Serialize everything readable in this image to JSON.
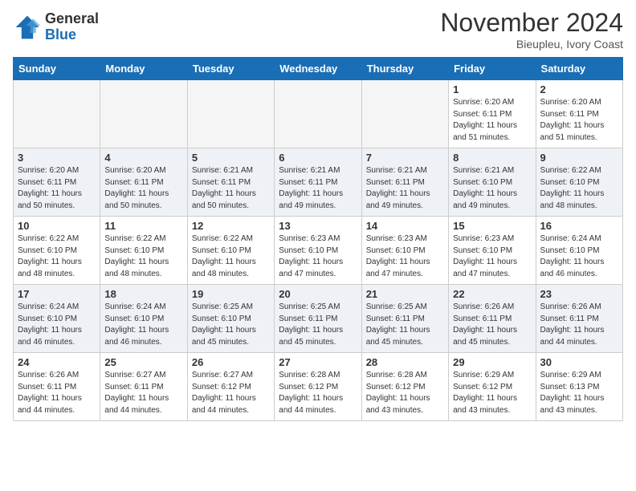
{
  "header": {
    "logo": {
      "general": "General",
      "blue": "Blue"
    },
    "title": "November 2024",
    "location": "Bieupleu, Ivory Coast"
  },
  "weekdays": [
    "Sunday",
    "Monday",
    "Tuesday",
    "Wednesday",
    "Thursday",
    "Friday",
    "Saturday"
  ],
  "weeks": [
    [
      {
        "day": "",
        "info": ""
      },
      {
        "day": "",
        "info": ""
      },
      {
        "day": "",
        "info": ""
      },
      {
        "day": "",
        "info": ""
      },
      {
        "day": "",
        "info": ""
      },
      {
        "day": "1",
        "info": "Sunrise: 6:20 AM\nSunset: 6:11 PM\nDaylight: 11 hours\nand 51 minutes."
      },
      {
        "day": "2",
        "info": "Sunrise: 6:20 AM\nSunset: 6:11 PM\nDaylight: 11 hours\nand 51 minutes."
      }
    ],
    [
      {
        "day": "3",
        "info": "Sunrise: 6:20 AM\nSunset: 6:11 PM\nDaylight: 11 hours\nand 50 minutes."
      },
      {
        "day": "4",
        "info": "Sunrise: 6:20 AM\nSunset: 6:11 PM\nDaylight: 11 hours\nand 50 minutes."
      },
      {
        "day": "5",
        "info": "Sunrise: 6:21 AM\nSunset: 6:11 PM\nDaylight: 11 hours\nand 50 minutes."
      },
      {
        "day": "6",
        "info": "Sunrise: 6:21 AM\nSunset: 6:11 PM\nDaylight: 11 hours\nand 49 minutes."
      },
      {
        "day": "7",
        "info": "Sunrise: 6:21 AM\nSunset: 6:11 PM\nDaylight: 11 hours\nand 49 minutes."
      },
      {
        "day": "8",
        "info": "Sunrise: 6:21 AM\nSunset: 6:10 PM\nDaylight: 11 hours\nand 49 minutes."
      },
      {
        "day": "9",
        "info": "Sunrise: 6:22 AM\nSunset: 6:10 PM\nDaylight: 11 hours\nand 48 minutes."
      }
    ],
    [
      {
        "day": "10",
        "info": "Sunrise: 6:22 AM\nSunset: 6:10 PM\nDaylight: 11 hours\nand 48 minutes."
      },
      {
        "day": "11",
        "info": "Sunrise: 6:22 AM\nSunset: 6:10 PM\nDaylight: 11 hours\nand 48 minutes."
      },
      {
        "day": "12",
        "info": "Sunrise: 6:22 AM\nSunset: 6:10 PM\nDaylight: 11 hours\nand 48 minutes."
      },
      {
        "day": "13",
        "info": "Sunrise: 6:23 AM\nSunset: 6:10 PM\nDaylight: 11 hours\nand 47 minutes."
      },
      {
        "day": "14",
        "info": "Sunrise: 6:23 AM\nSunset: 6:10 PM\nDaylight: 11 hours\nand 47 minutes."
      },
      {
        "day": "15",
        "info": "Sunrise: 6:23 AM\nSunset: 6:10 PM\nDaylight: 11 hours\nand 47 minutes."
      },
      {
        "day": "16",
        "info": "Sunrise: 6:24 AM\nSunset: 6:10 PM\nDaylight: 11 hours\nand 46 minutes."
      }
    ],
    [
      {
        "day": "17",
        "info": "Sunrise: 6:24 AM\nSunset: 6:10 PM\nDaylight: 11 hours\nand 46 minutes."
      },
      {
        "day": "18",
        "info": "Sunrise: 6:24 AM\nSunset: 6:10 PM\nDaylight: 11 hours\nand 46 minutes."
      },
      {
        "day": "19",
        "info": "Sunrise: 6:25 AM\nSunset: 6:10 PM\nDaylight: 11 hours\nand 45 minutes."
      },
      {
        "day": "20",
        "info": "Sunrise: 6:25 AM\nSunset: 6:11 PM\nDaylight: 11 hours\nand 45 minutes."
      },
      {
        "day": "21",
        "info": "Sunrise: 6:25 AM\nSunset: 6:11 PM\nDaylight: 11 hours\nand 45 minutes."
      },
      {
        "day": "22",
        "info": "Sunrise: 6:26 AM\nSunset: 6:11 PM\nDaylight: 11 hours\nand 45 minutes."
      },
      {
        "day": "23",
        "info": "Sunrise: 6:26 AM\nSunset: 6:11 PM\nDaylight: 11 hours\nand 44 minutes."
      }
    ],
    [
      {
        "day": "24",
        "info": "Sunrise: 6:26 AM\nSunset: 6:11 PM\nDaylight: 11 hours\nand 44 minutes."
      },
      {
        "day": "25",
        "info": "Sunrise: 6:27 AM\nSunset: 6:11 PM\nDaylight: 11 hours\nand 44 minutes."
      },
      {
        "day": "26",
        "info": "Sunrise: 6:27 AM\nSunset: 6:12 PM\nDaylight: 11 hours\nand 44 minutes."
      },
      {
        "day": "27",
        "info": "Sunrise: 6:28 AM\nSunset: 6:12 PM\nDaylight: 11 hours\nand 44 minutes."
      },
      {
        "day": "28",
        "info": "Sunrise: 6:28 AM\nSunset: 6:12 PM\nDaylight: 11 hours\nand 43 minutes."
      },
      {
        "day": "29",
        "info": "Sunrise: 6:29 AM\nSunset: 6:12 PM\nDaylight: 11 hours\nand 43 minutes."
      },
      {
        "day": "30",
        "info": "Sunrise: 6:29 AM\nSunset: 6:13 PM\nDaylight: 11 hours\nand 43 minutes."
      }
    ]
  ]
}
